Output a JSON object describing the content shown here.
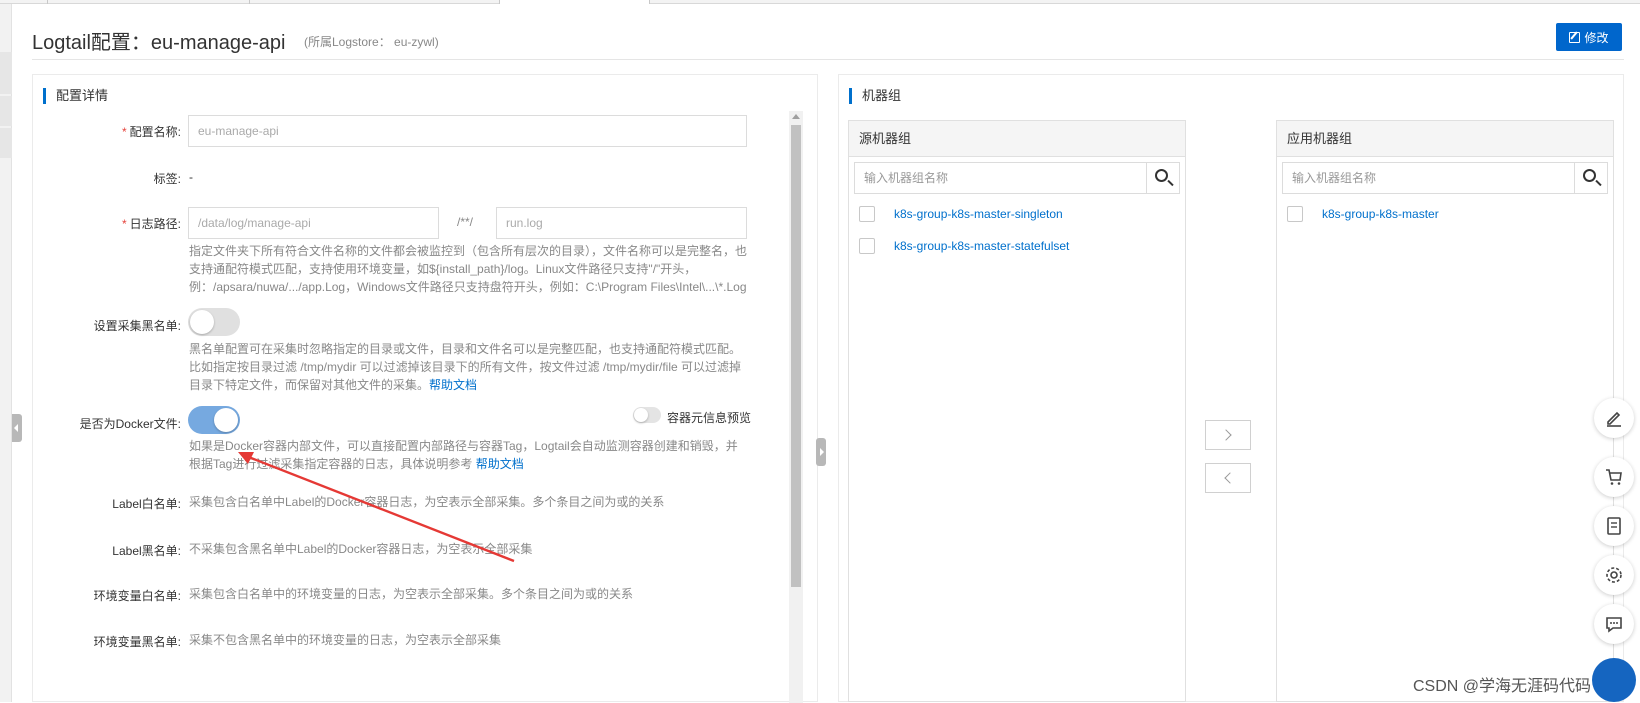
{
  "header": {
    "title": "Logtail配置：eu-manage-api",
    "logstore": "(所属Logstore： eu-zywl)",
    "edit_label": "修改"
  },
  "config_panel": {
    "title": "配置详情",
    "name": {
      "label": "配置名称:",
      "value": "eu-manage-api"
    },
    "tags": {
      "label": "标签:",
      "value": "-"
    },
    "log_path": {
      "label": "日志路径:",
      "dir": "/data/log/manage-api",
      "separator": "/**/",
      "file": "run.log",
      "help": "指定文件夹下所有符合文件名称的文件都会被监控到（包含所有层次的目录），文件名称可以是完整名，也支持通配符模式匹配，支持使用环境变量，如${install_path}/log。Linux文件路径只支持\"/\"开头，例：/apsara/nuwa/.../app.Log，Windows文件路径只支持盘符开头，例如：C:\\Program Files\\Intel\\...\\*.Log"
    },
    "blacklist": {
      "label": "设置采集黑名单:",
      "enabled": false,
      "help": "黑名单配置可在采集时忽略指定的目录或文件，目录和文件名可以是完整匹配，也支持通配符模式匹配。比如指定按目录过滤 /tmp/mydir 可以过滤掉该目录下的所有文件，按文件过滤 /tmp/mydir/file 可以过滤掉目录下特定文件，而保留对其他文件的采集。",
      "help_link": "帮助文档"
    },
    "docker": {
      "label": "是否为Docker文件:",
      "enabled": true,
      "preview_label": "容器元信息预览",
      "preview_enabled": false,
      "help": "如果是Docker容器内部文件，可以直接配置内部路径与容器Tag，Logtail会自动监测容器创建和销毁，并根据Tag进行过滤采集指定容器的日志，具体说明参考",
      "help_link": "帮助文档"
    },
    "label_whitelist": {
      "label": "Label白名单:",
      "text": "采集包含白名单中Label的Docker容器日志，为空表示全部采集。多个条目之间为或的关系"
    },
    "label_blacklist": {
      "label": "Label黑名单:",
      "text": "不采集包含黑名单中Label的Docker容器日志，为空表示全部采集"
    },
    "env_whitelist": {
      "label": "环境变量白名单:",
      "text": "采集包含白名单中的环境变量的日志，为空表示全部采集。多个条目之间为或的关系"
    },
    "env_blacklist": {
      "label": "环境变量黑名单:",
      "text": "采集不包含黑名单中的环境变量的日志，为空表示全部采集"
    }
  },
  "machine_panel": {
    "title": "机器组",
    "source": {
      "title": "源机器组",
      "placeholder": "输入机器组名称",
      "items": [
        "k8s-group-k8s-master-singleton",
        "k8s-group-k8s-master-statefulset"
      ]
    },
    "applied": {
      "title": "应用机器组",
      "placeholder": "输入机器组名称",
      "items": [
        "k8s-group-k8s-master"
      ]
    }
  },
  "side_tools": [
    "edit-icon",
    "cart-icon",
    "document-icon",
    "gear-icon",
    "message-icon"
  ],
  "watermark": "CSDN @学海无涯码代码",
  "colors": {
    "primary": "#0066cc",
    "link": "#0070cc",
    "annotation_arrow": "#e53935"
  }
}
